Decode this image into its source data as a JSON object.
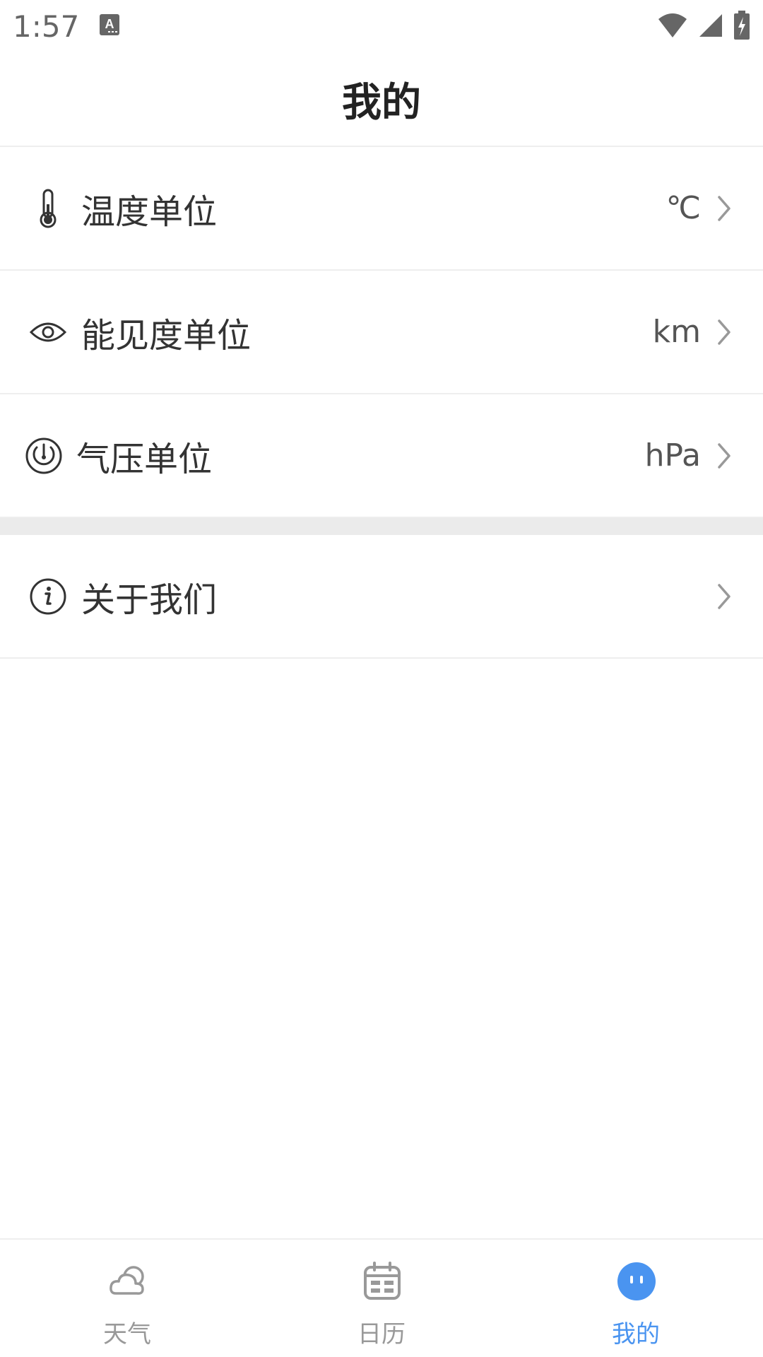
{
  "status_bar": {
    "time": "1:57"
  },
  "header": {
    "title": "我的"
  },
  "settings": [
    {
      "label": "温度单位",
      "value": "℃",
      "icon": "thermometer-icon"
    },
    {
      "label": "能见度单位",
      "value": "km",
      "icon": "eye-icon"
    },
    {
      "label": "气压单位",
      "value": "hPa",
      "icon": "gauge-icon"
    }
  ],
  "about": {
    "label": "关于我们",
    "icon": "info-icon"
  },
  "bottom_nav": {
    "items": [
      {
        "label": "天气",
        "icon": "cloud-icon",
        "active": false
      },
      {
        "label": "日历",
        "icon": "calendar-icon",
        "active": false
      },
      {
        "label": "我的",
        "icon": "face-icon",
        "active": true
      }
    ]
  },
  "colors": {
    "accent": "#4a94f0",
    "text": "#333333",
    "muted": "#999999",
    "divider": "#eeeeee",
    "section_gap": "#ebebeb"
  }
}
